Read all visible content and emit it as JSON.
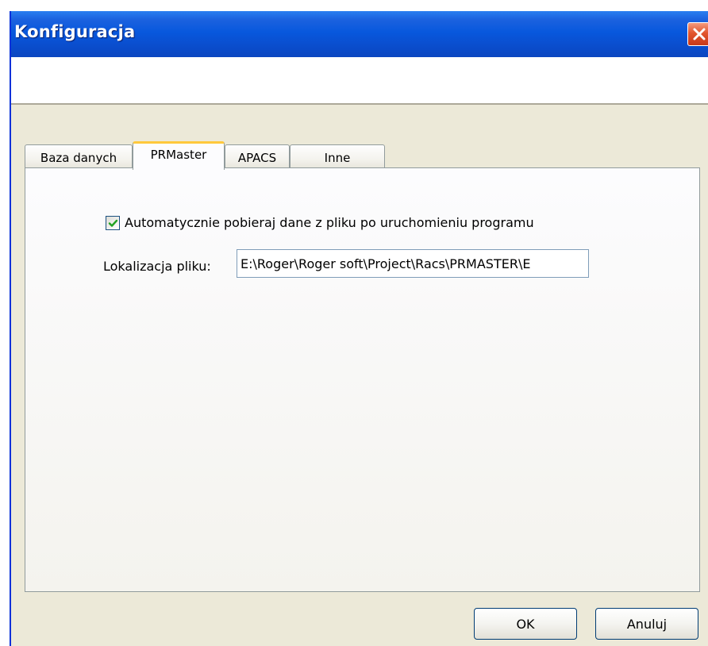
{
  "window": {
    "title": "Konfiguracja"
  },
  "tabs": [
    {
      "label": "Baza danych",
      "active": false
    },
    {
      "label": "PRMaster",
      "active": true
    },
    {
      "label": "APACS",
      "active": false
    },
    {
      "label": "Inne",
      "active": false
    }
  ],
  "prmaster": {
    "auto_load_label": "Automatycznie pobieraj dane z pliku po uruchomieniu programu",
    "auto_load_checked": true,
    "file_location_label": "Lokalizacja pliku:",
    "file_location_value": "E:\\Roger\\Roger soft\\Project\\Racs\\PRMASTER\\E"
  },
  "buttons": {
    "ok": "OK",
    "cancel": "Anuluj"
  },
  "icons": {
    "close": "close-icon",
    "check": "checkmark-icon"
  },
  "colors": {
    "titlebar": "#0858dd",
    "close_button": "#e2552e",
    "active_tab_accent": "#ffc83c",
    "dialog_background": "#ece9d8",
    "checkmark": "#21a121"
  }
}
